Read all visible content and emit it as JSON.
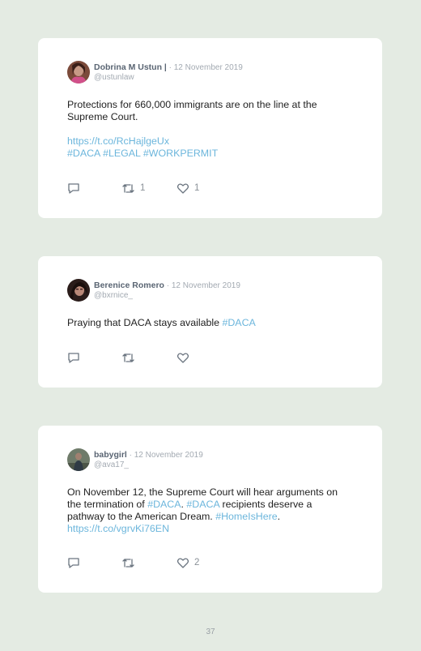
{
  "tweets": [
    {
      "name": "Dobrina M Ustun",
      "name_mark": " |",
      "separator": " · ",
      "date": "12 November 2019",
      "handle": "@ustunlaw",
      "text": "Protections for 660,000 immigrants are on the line at the Supreme Court.",
      "link": "https://t.co/RcHajlgeUx",
      "hashtags": "#DACA #LEGAL #WORKPERMIT",
      "retweets": "1",
      "likes": "1"
    },
    {
      "name": "Berenice Romero",
      "separator": " · ",
      "date": "12 November 2019",
      "handle": "@bxrnice_",
      "text": "Praying that DACA stays available ",
      "hashtag": "#DACA"
    },
    {
      "name": "babygirl",
      "separator": " · ",
      "date": "12 November 2019",
      "handle": "@ava17_",
      "text_1": "On November 12, the Supreme Court will hear arguments on the termination of ",
      "tag_1": "#DACA",
      "text_2": ". ",
      "tag_2": "#DACA",
      "text_3": " recipients deserve a pathway to the American Dream. ",
      "tag_3": "#HomeIsHere",
      "text_4": ".",
      "link": "https://t.co/vgrvKi76EN",
      "likes": "2"
    }
  ],
  "page_number": "37",
  "colors": {
    "background": "#e4ebe3",
    "card": "#ffffff",
    "link": "#6cb6dc",
    "name": "#5a6573",
    "muted": "#a3aab2"
  },
  "icons": [
    "reply-icon",
    "retweet-icon",
    "like-icon"
  ]
}
